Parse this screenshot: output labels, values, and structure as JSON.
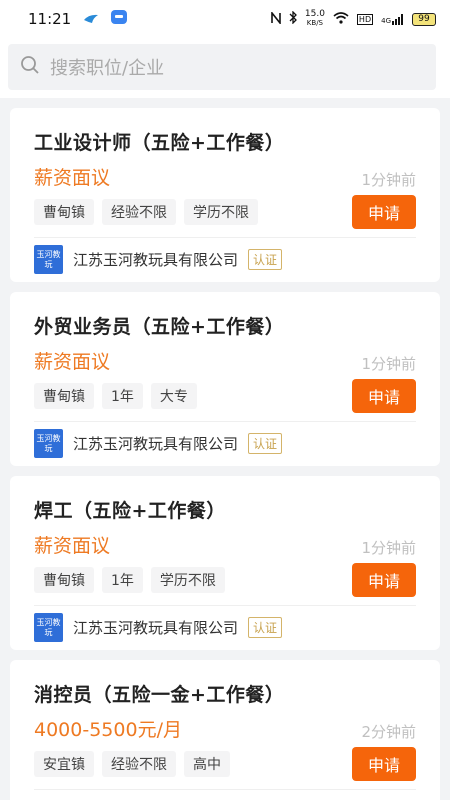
{
  "status": {
    "time": "11:21",
    "net_speed": "15.0",
    "net_unit": "KB/S",
    "hd": "HD",
    "signal": "4G",
    "battery": "99"
  },
  "search": {
    "placeholder": "搜索职位/企业"
  },
  "jobs": [
    {
      "title": "工业设计师（五险+工作餐）",
      "salary": "薪资面议",
      "time": "1分钟前",
      "tags": [
        "曹甸镇",
        "经验不限",
        "学历不限"
      ],
      "apply": "申请",
      "company": "江苏玉河教玩具有限公司",
      "logo": "玉河教玩",
      "verified": "认证"
    },
    {
      "title": "外贸业务员（五险+工作餐）",
      "salary": "薪资面议",
      "time": "1分钟前",
      "tags": [
        "曹甸镇",
        "1年",
        "大专"
      ],
      "apply": "申请",
      "company": "江苏玉河教玩具有限公司",
      "logo": "玉河教玩",
      "verified": "认证"
    },
    {
      "title": "焊工（五险+工作餐）",
      "salary": "薪资面议",
      "time": "1分钟前",
      "tags": [
        "曹甸镇",
        "1年",
        "学历不限"
      ],
      "apply": "申请",
      "company": "江苏玉河教玩具有限公司",
      "logo": "玉河教玩",
      "verified": "认证"
    },
    {
      "title": "消控员（五险一金+工作餐）",
      "salary": "4000-5500元/月",
      "time": "2分钟前",
      "tags": [
        "安宜镇",
        "经验不限",
        "高中"
      ],
      "apply": "申请",
      "company": "",
      "logo": "",
      "verified": ""
    }
  ]
}
